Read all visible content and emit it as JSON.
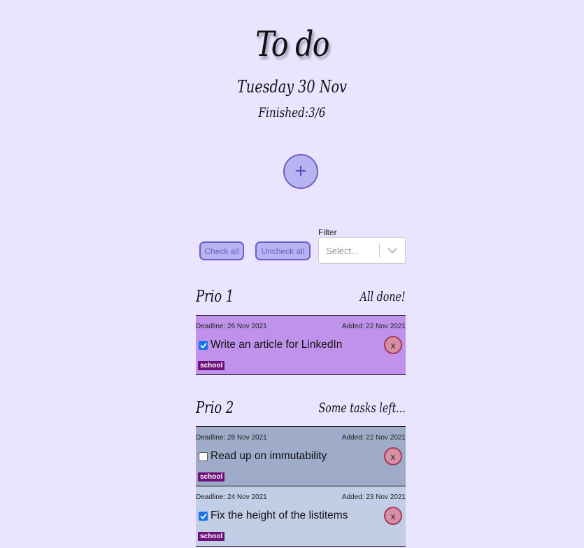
{
  "header": {
    "title": "To do",
    "date": "Tuesday 30 Nov",
    "finished": "Finished:3/6"
  },
  "add_button": {
    "icon": "plus-icon",
    "label": "+"
  },
  "controls": {
    "check_all_label": "Check all",
    "uncheck_all_label": "Uncheck all",
    "filter_label": "Filter",
    "filter_placeholder": "Select..."
  },
  "colors": {
    "background": "#ebe4ff",
    "accent": "#6b5fc9",
    "prio1_task": "#c192ec",
    "prio2_task_unchecked": "#9eacc9",
    "prio2_task_checked": "#c2cde6",
    "tag": "#6e0f7a"
  },
  "sections": [
    {
      "title": "Prio 1",
      "status": "All done!",
      "tasks": [
        {
          "deadline": "Deadline: 26 Nov 2021",
          "added": "Added: 22 Nov 2021",
          "name": "Write an article for LinkedIn",
          "checked": true,
          "tag": "school",
          "delete_label": "x"
        }
      ]
    },
    {
      "title": "Prio 2",
      "status": "Some tasks left...",
      "tasks": [
        {
          "deadline": "Deadline: 28 Nov 2021",
          "added": "Added: 22 Nov 2021",
          "name": "Read up on immutability",
          "checked": false,
          "tag": "school",
          "delete_label": "x"
        },
        {
          "deadline": "Deadline: 24 Nov 2021",
          "added": "Added: 23 Nov 2021",
          "name": "Fix the height of the listitems",
          "checked": true,
          "tag": "school",
          "delete_label": "x"
        }
      ]
    }
  ]
}
